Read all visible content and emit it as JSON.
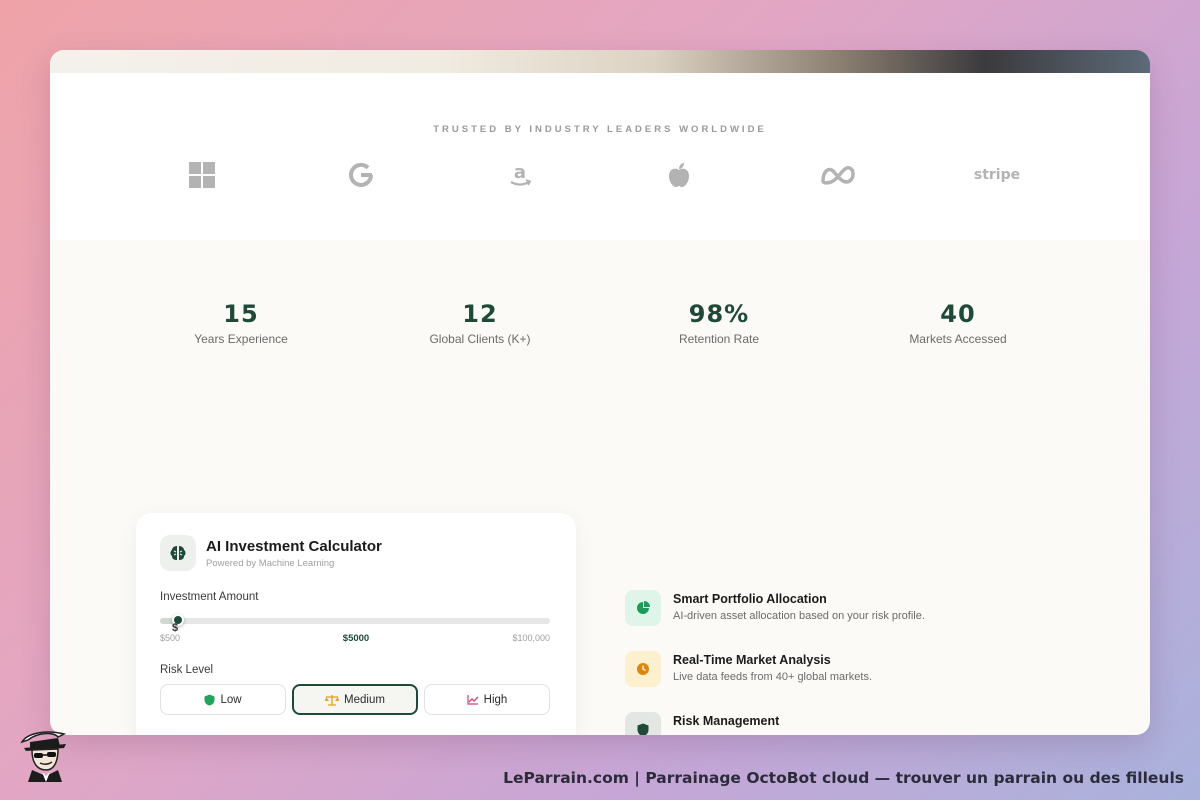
{
  "trusted": {
    "heading": "TRUSTED BY INDUSTRY LEADERS WORLDWIDE",
    "logos": [
      {
        "name": "windows-logo",
        "text": ""
      },
      {
        "name": "google-logo",
        "text": ""
      },
      {
        "name": "amazon-logo",
        "text": ""
      },
      {
        "name": "apple-logo",
        "text": ""
      },
      {
        "name": "meta-logo",
        "text": ""
      },
      {
        "name": "stripe-logo",
        "text": "stripe"
      }
    ]
  },
  "stats": [
    {
      "value": "15",
      "label": "Years Experience"
    },
    {
      "value": "12",
      "label": "Global Clients (K+)"
    },
    {
      "value": "98%",
      "label": "Retention Rate"
    },
    {
      "value": "40",
      "label": "Markets Accessed"
    }
  ],
  "calculator": {
    "title": "AI Investment Calculator",
    "subtitle": "Powered by Machine Learning",
    "amount_label": "Investment Amount",
    "slider": {
      "min_label": "$500",
      "value_label": "$5000",
      "max_label": "$100,000",
      "min": 500,
      "max": 100000,
      "value": 5000,
      "currency_glyph": "$"
    },
    "risk_label": "Risk Level",
    "risk_options": [
      {
        "label": "Low",
        "active": false,
        "icon": "shield-icon",
        "color": "#22a35a"
      },
      {
        "label": "Medium",
        "active": true,
        "icon": "scale-icon",
        "color": "#e0a020"
      },
      {
        "label": "High",
        "active": false,
        "icon": "trend-up-icon",
        "color": "#d2457a"
      }
    ]
  },
  "features": [
    {
      "title": "Smart Portfolio Allocation",
      "desc": "AI-driven asset allocation based on your risk profile.",
      "icon": "pie-chart-icon",
      "bg": "#dff5ea",
      "color": "#1e9a5b"
    },
    {
      "title": "Real-Time Market Analysis",
      "desc": "Live data feeds from 40+ global markets.",
      "icon": "clock-icon",
      "bg": "#fdf0cf",
      "color": "#d9870f"
    },
    {
      "title": "Risk Management",
      "desc": "",
      "icon": "shield-icon",
      "bg": "#e3e7e4",
      "color": "#1f4a3a"
    }
  ],
  "footer": {
    "text": "LeParrain.com | Parrainage OctoBot cloud — trouver un parrain ou des filleuls"
  },
  "colors": {
    "accent": "#1f4a3a",
    "background": "#fbfaf6"
  }
}
